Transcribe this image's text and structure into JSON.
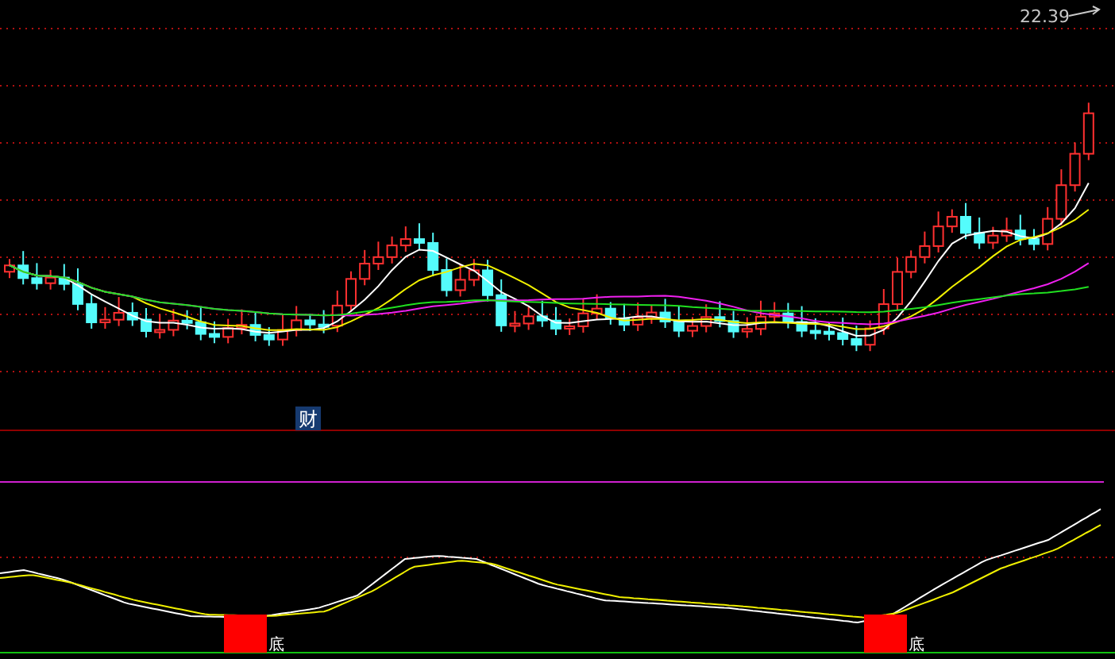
{
  "price_panel": {
    "high_label": "22.39",
    "event_marker": "财"
  },
  "indicator_panel": {
    "signals": [
      {
        "label": "底"
      },
      {
        "label": "底"
      }
    ]
  }
}
